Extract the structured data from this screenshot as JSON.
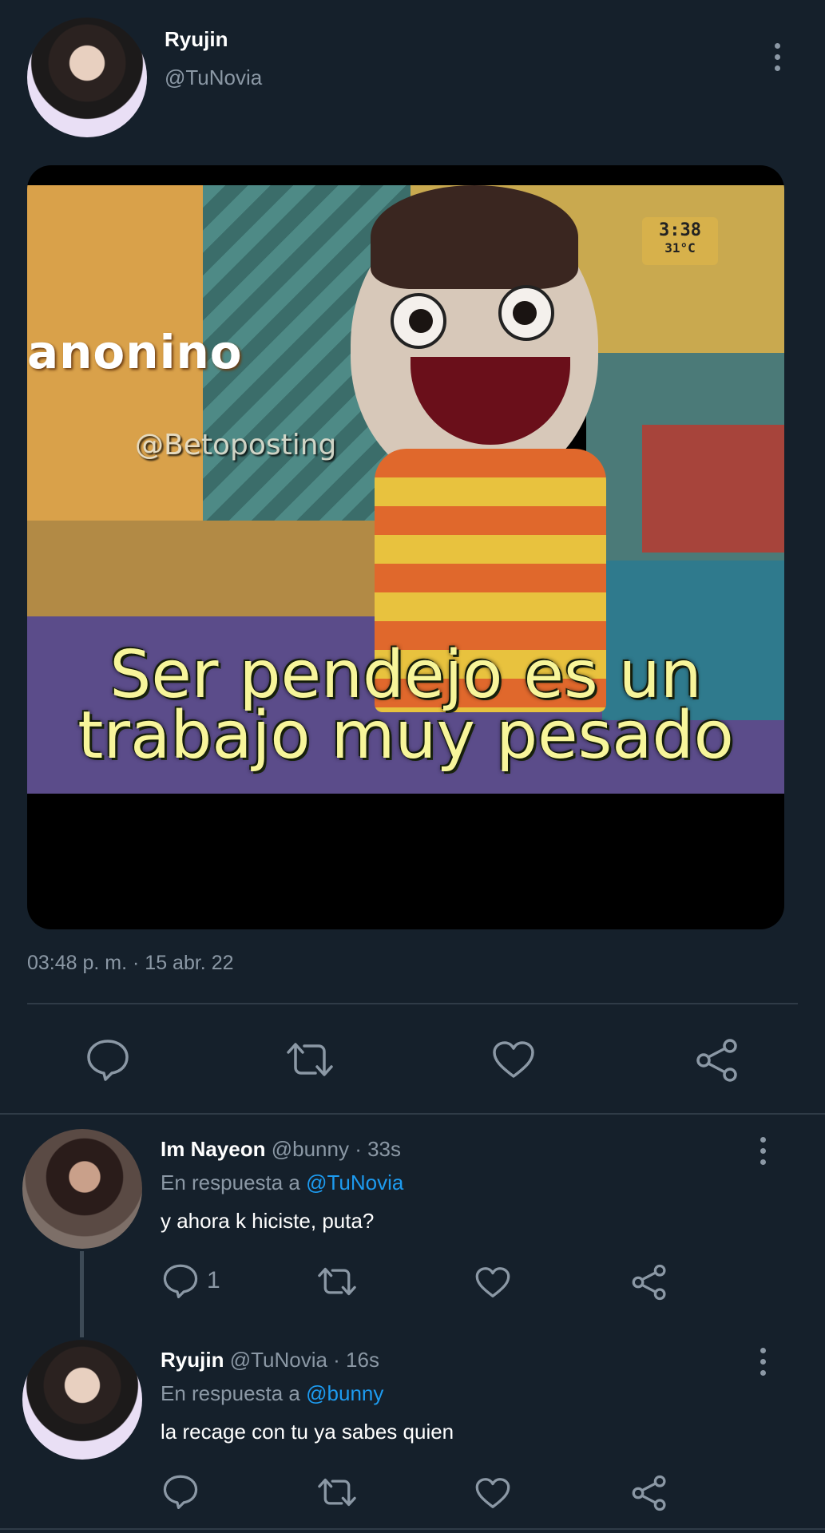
{
  "main_tweet": {
    "display_name": "Ryujin",
    "handle": "@TuNovia",
    "media": {
      "caption_line_1": "Ser pendejo es un",
      "caption_line_2": "trabajo muy pesado",
      "watermark": "@Betoposting",
      "box_text": "anonino",
      "clock_line_1": "3:38",
      "clock_line_2": "31°C"
    },
    "timestamp": "03:48 p. m. · 15 abr. 22",
    "actions": [
      "reply-icon",
      "retweet-icon",
      "like-icon",
      "share-icon"
    ]
  },
  "replies": [
    {
      "display_name": "Im Nayeon",
      "handle_time": "@bunny · 33s",
      "in_reply_prefix": "En respuesta a",
      "in_reply_mention": "@TuNovia",
      "text": "y ahora k hiciste, puta?",
      "reply_count": "1"
    },
    {
      "display_name": "Ryujin",
      "handle_time": "@TuNovia · 16s",
      "in_reply_prefix": "En respuesta a",
      "in_reply_mention": "@bunny",
      "text": "la recage con tu ya sabes quien",
      "reply_count": ""
    }
  ],
  "colors": {
    "background": "#15202b",
    "secondary_text": "#8b98a5",
    "link": "#1d9bf0",
    "divider": "#2f3b47"
  }
}
